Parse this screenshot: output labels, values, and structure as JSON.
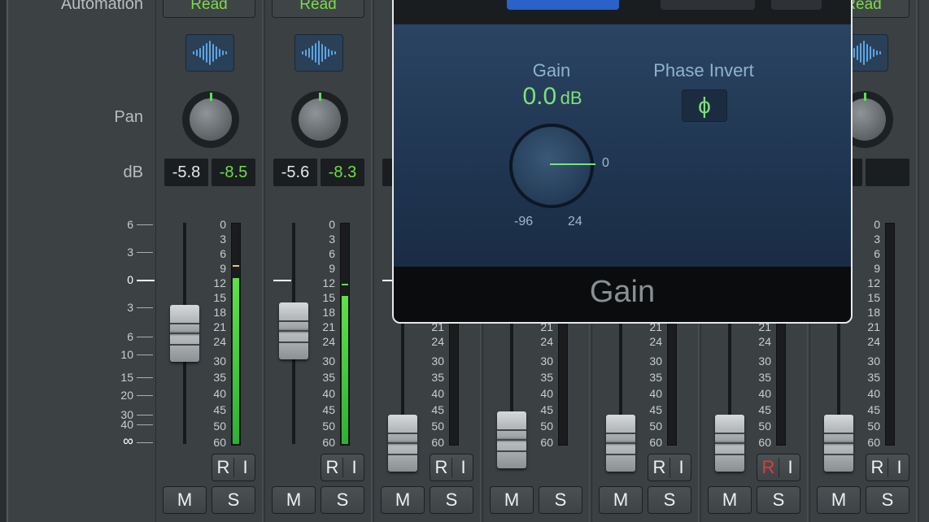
{
  "labels": {
    "automation": "Automation",
    "pan": "Pan",
    "db": "dB"
  },
  "fader_scale": [
    "6",
    "3",
    "0",
    "3",
    "6",
    "10",
    "15",
    "20",
    "30",
    "40",
    "∞"
  ],
  "meter_scale": [
    "0",
    "3",
    "6",
    "9",
    "12",
    "15",
    "18",
    "21",
    "24",
    "30",
    "35",
    "40",
    "45",
    "50",
    "60"
  ],
  "meter_scale_lower": [
    "21",
    "24",
    "30",
    "35",
    "40",
    "45",
    "50",
    "60"
  ],
  "channels": [
    {
      "automation": "Read",
      "db_volume": "-5.8",
      "db_peak": "-8.5",
      "rec": "R",
      "input": "I",
      "mute": "M",
      "solo": "S",
      "meter_level": 0.74
    },
    {
      "automation": "Read",
      "db_volume": "-5.6",
      "db_peak": "-8.3",
      "rec": "R",
      "input": "I",
      "mute": "M",
      "solo": "S",
      "meter_level": 0.67
    },
    {
      "rec": "R",
      "input": "I",
      "mute": "M",
      "solo": "S"
    },
    {
      "mute": "M",
      "solo": "S"
    },
    {
      "rec": "R",
      "input": "I",
      "mute": "M",
      "solo": "S"
    },
    {
      "rec": "R",
      "input": "I",
      "mute": "M",
      "solo": "S",
      "rec_armed": true
    },
    {
      "automation": "Read",
      "rec": "R",
      "input": "I",
      "mute": "M",
      "solo": "S"
    }
  ],
  "plugin": {
    "gain_label": "Gain",
    "gain_value": "0.0",
    "gain_unit": "dB",
    "knob_min": "-96",
    "knob_max": "24",
    "knob_zero": "0",
    "phase_label": "Phase Invert",
    "phase_symbol": "ϕ",
    "footer_title": "Gain"
  },
  "colors": {
    "green": "#6fdc4a",
    "rec_red": "#e03a3a",
    "plugin_blue": "#2a62c9"
  }
}
